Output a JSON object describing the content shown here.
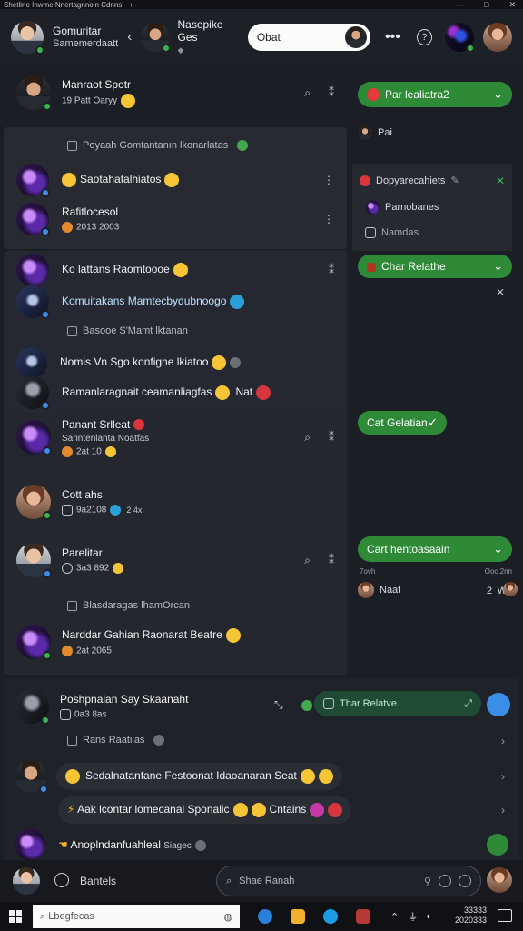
{
  "titlebar": {
    "title": "Shetline Inwme Nnertagnnoin Cdnns",
    "plus": "+",
    "min": "—",
    "max": "□",
    "close": "✕"
  },
  "header": {
    "group_title": "Gomuritar",
    "group_sub": "Samemerdaatt",
    "chevron": "‹",
    "contact_name": "Nasepike Ges",
    "contact_sub": "◆",
    "pill_text": "Obat",
    "more_icon": "•••",
    "help_icon": "?",
    "chev_down": "⌄"
  },
  "left": {
    "top_row": {
      "name": "Manraot Spotr",
      "meta": "19 Patt Oaryy",
      "more": "⌕",
      "pin": "⁑"
    },
    "notice1": "Poyaah Gomtantanın lkonarlatas",
    "row1": {
      "name": "Saotahatalhiatos",
      "kebab": "⋮"
    },
    "row2": {
      "name": "Rafitlocesol",
      "meta": "2013 2003",
      "kebab": "⋮"
    },
    "row3": {
      "name": "Ko lattans Raomtoooe",
      "pin": "⁑"
    },
    "row4": {
      "name": "Komuitakans Mamtecbydubnoogo"
    },
    "notice2": "Basooe S'Mamt lktanan",
    "row5": {
      "name": "Nomis Vn Sgo konfigne lkiatoo"
    },
    "row6": {
      "name": "Ramanlaragnait ceamanliagfas",
      "tag": "Nat"
    },
    "row7": {
      "name": "Panant Srlleat",
      "meta": "Sanntenlanta Noatfas",
      "meta2": "2at 10",
      "more": "⌕",
      "pin": "⁑"
    },
    "row8": {
      "name": "Cott ahs",
      "meta": "9a2108",
      "extra": "2 4x"
    },
    "row9": {
      "name": "Parelitar",
      "meta": "3a3 892",
      "more": "⌕",
      "pin": "⁑"
    },
    "notice3": "Blasdaragas lhamOrcan",
    "row10": {
      "name": "Narddar Gahian Raonarat Beatre",
      "meta": "2at 2065"
    }
  },
  "right": {
    "bubble1": "Par lealiatra2",
    "pai": "Pai",
    "r_title": "Dopyarecahiets",
    "r_item1": "Parnobanes",
    "r_item2": "Namdas",
    "bubble2": "Char Relathe",
    "close1": "✕",
    "close2": "⨯",
    "bubble3": "Cat Gelatian",
    "bubble4": "Cart hentoasaain",
    "r_time1": "7ovh",
    "r_time2": "Ooc 2nn",
    "r_name": "Naat",
    "r_tag": "W",
    "r_num": "2"
  },
  "bottom": {
    "row1": {
      "name": "Poshpnalan Say Skaanaht",
      "meta": "0a3 8as",
      "chip": "Thar Relatve"
    },
    "notice": "Rans Raatiias",
    "row2": {
      "text": "Sedalnatanfane Festoonat Idaoanaran Seat"
    },
    "row3": {
      "text": "Aak lcontar lomecanal Sponalic",
      "tail": "Cntains"
    },
    "row4": {
      "text": "Anoplndanfuahleal",
      "tail": "Siagec"
    }
  },
  "footer": {
    "label": "Bantels",
    "search_placeholder": "Shae Ranah"
  },
  "taskbar": {
    "search_placeholder": "Lbegfecas",
    "time": "33333",
    "date": "2020333"
  }
}
